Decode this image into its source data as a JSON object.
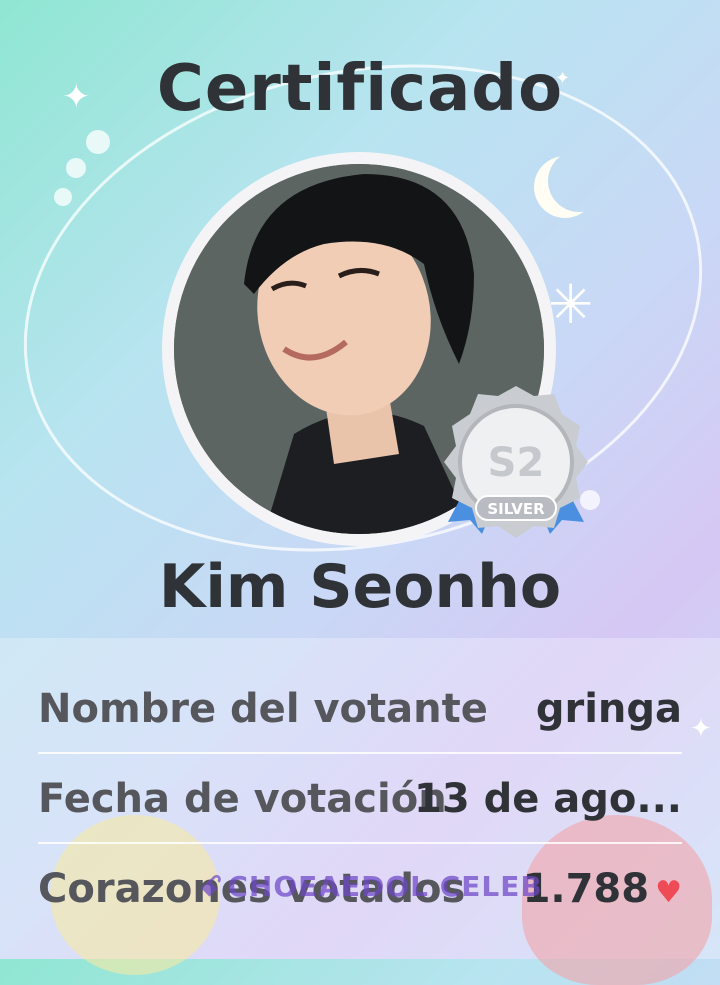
{
  "certificate": {
    "title": "Certificado",
    "celebrity_name": "Kim Seonho",
    "badge": {
      "tier": "SILVER"
    },
    "rows": [
      {
        "label": "Nombre del votante",
        "value": "gringa"
      },
      {
        "label": "Fecha de votación",
        "value": "13 de ago..."
      },
      {
        "label": "Corazones votados",
        "value": "1.788"
      }
    ],
    "watermark": "CHOEAEDOL CELEB"
  },
  "icons": {
    "badge": "silver-medal-icon",
    "heart": "heart-icon",
    "moon": "crescent-moon-icon",
    "sparkle": "sparkle-icon"
  },
  "colors": {
    "heart": "#ee4b57",
    "text_dark": "#2f3236",
    "label_gray": "#55575c",
    "badge_silver": "#c9ccd1",
    "ribbon_blue": "#4a8fe0"
  }
}
